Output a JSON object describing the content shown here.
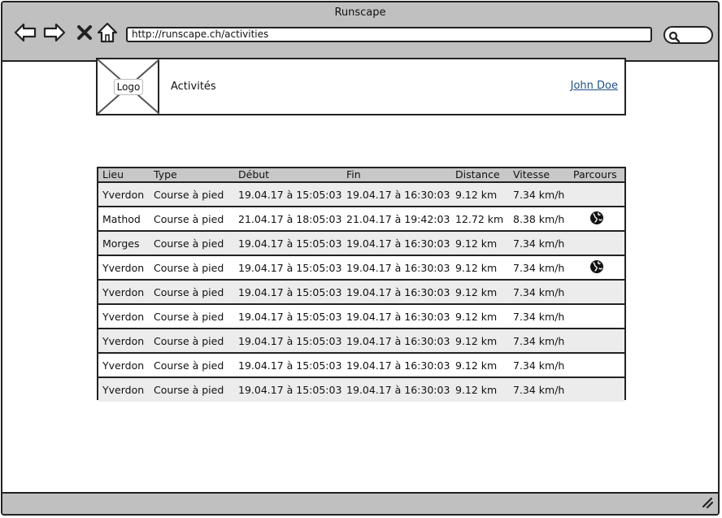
{
  "browser": {
    "title": "Runscape",
    "url": "http://runscape.ch/activities",
    "icons": [
      "back-arrow-icon",
      "forward-arrow-icon",
      "close-icon",
      "home-icon",
      "search-icon",
      "resize-grip-icon"
    ]
  },
  "header": {
    "logo_label": "Logo",
    "page_title": "Activités",
    "user_name": "John Doe"
  },
  "table": {
    "columns": [
      "Lieu",
      "Type",
      "Début",
      "Fin",
      "Distance",
      "Vitesse",
      "Parcours"
    ],
    "rows": [
      {
        "lieu": "Yverdon",
        "type": "Course à pied",
        "debut": "19.04.17 à 15:05:03",
        "fin": "19.04.17 à 16:30:03",
        "distance": "9.12 km",
        "vitesse": "7.34 km/h",
        "parcours": false
      },
      {
        "lieu": "Mathod",
        "type": "Course à pied",
        "debut": "21.04.17 à 18:05:03",
        "fin": "21.04.17 à 19:42:03",
        "distance": "12.72 km",
        "vitesse": "8.38 km/h",
        "parcours": true
      },
      {
        "lieu": "Morges",
        "type": "Course à pied",
        "debut": "19.04.17 à 15:05:03",
        "fin": "19.04.17 à 16:30:03",
        "distance": "9.12 km",
        "vitesse": "7.34 km/h",
        "parcours": false
      },
      {
        "lieu": "Yverdon",
        "type": "Course à pied",
        "debut": "19.04.17 à 15:05:03",
        "fin": "19.04.17 à 16:30:03",
        "distance": "9.12 km",
        "vitesse": "7.34 km/h",
        "parcours": true
      },
      {
        "lieu": "Yverdon",
        "type": "Course à pied",
        "debut": "19.04.17 à 15:05:03",
        "fin": "19.04.17 à 16:30:03",
        "distance": "9.12 km",
        "vitesse": "7.34 km/h",
        "parcours": false
      },
      {
        "lieu": "Yverdon",
        "type": "Course à pied",
        "debut": "19.04.17 à 15:05:03",
        "fin": "19.04.17 à 16:30:03",
        "distance": "9.12 km",
        "vitesse": "7.34 km/h",
        "parcours": false
      },
      {
        "lieu": "Yverdon",
        "type": "Course à pied",
        "debut": "19.04.17 à 15:05:03",
        "fin": "19.04.17 à 16:30:03",
        "distance": "9.12 km",
        "vitesse": "7.34 km/h",
        "parcours": false
      },
      {
        "lieu": "Yverdon",
        "type": "Course à pied",
        "debut": "19.04.17 à 15:05:03",
        "fin": "19.04.17 à 16:30:03",
        "distance": "9.12 km",
        "vitesse": "7.34 km/h",
        "parcours": false
      },
      {
        "lieu": "Yverdon",
        "type": "Course à pied",
        "debut": "19.04.17 à 15:05:03",
        "fin": "19.04.17 à 16:30:03",
        "distance": "9.12 km",
        "vitesse": "7.34 km/h",
        "parcours": false
      }
    ]
  },
  "colors": {
    "chrome": "#c0c0c0",
    "header_row": "#c8c8c8",
    "alt_row": "#ececec",
    "link": "#1f4f86"
  }
}
